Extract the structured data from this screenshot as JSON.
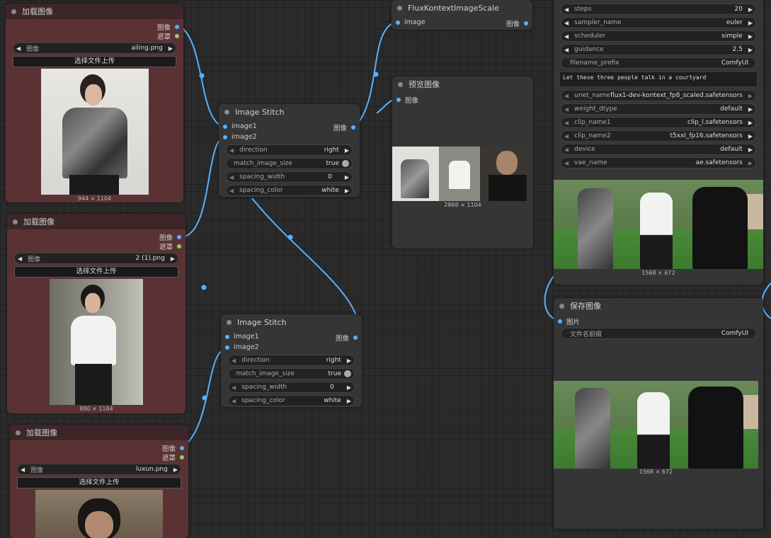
{
  "load_nodes": [
    {
      "title": "加载图像",
      "output_image": "图像",
      "output_mask": "遮罩",
      "image_label": "图像",
      "image_value": "ailing.png",
      "upload_label": "选择文件上传",
      "size": "944 × 1104"
    },
    {
      "title": "加载图像",
      "output_image": "图像",
      "output_mask": "遮罩",
      "image_label": "图像",
      "image_value": "2 (1).png",
      "upload_label": "选择文件上传",
      "size": "880 × 1184"
    },
    {
      "title": "加载图像",
      "output_image": "图像",
      "output_mask": "遮罩",
      "image_label": "图像",
      "image_value": "luxun.png",
      "upload_label": "选择文件上传",
      "size": ""
    }
  ],
  "stitch_nodes": [
    {
      "title": "Image Stitch",
      "input1": "image1",
      "input2": "image2",
      "output": "图像",
      "widgets": [
        {
          "label": "direction",
          "value": "right"
        },
        {
          "label": "match_image_size",
          "value": "true"
        },
        {
          "label": "spacing_width",
          "value": "0"
        },
        {
          "label": "spacing_color",
          "value": "white"
        }
      ]
    },
    {
      "title": "Image Stitch",
      "input1": "image1",
      "input2": "image2",
      "output": "图像",
      "widgets": [
        {
          "label": "direction",
          "value": "right"
        },
        {
          "label": "match_image_size",
          "value": "true"
        },
        {
          "label": "spacing_width",
          "value": "0"
        },
        {
          "label": "spacing_color",
          "value": "white"
        }
      ]
    }
  ],
  "scale_node": {
    "title": "FluxKontextImageScale",
    "input": "image",
    "output": "图像"
  },
  "preview_node": {
    "title": "预览图像",
    "input": "图像",
    "size": "2868 × 1104"
  },
  "sampler_panel": {
    "widgets": [
      {
        "label": "steps",
        "value": "20"
      },
      {
        "label": "sampler_name",
        "value": "euler"
      },
      {
        "label": "scheduler",
        "value": "simple"
      },
      {
        "label": "guidance",
        "value": "2.5"
      }
    ],
    "filename_prefix": {
      "label": "filename_prefix",
      "value": "ComfyUI"
    },
    "prompt": "Let these three people talk in a courtyard",
    "loaders": [
      {
        "label": "unet_name",
        "value": "flux1-dev-kontext_fp8_scaled.safetensors"
      },
      {
        "label": "weight_dtype",
        "value": "default"
      },
      {
        "label": "clip_name1",
        "value": "clip_l.safetensors"
      },
      {
        "label": "clip_name2",
        "value": "t5xxl_fp16.safetensors"
      },
      {
        "label": "device",
        "value": "default"
      },
      {
        "label": "vae_name",
        "value": "ae.safetensors"
      }
    ],
    "result_size": "1568 × 672"
  },
  "save_node": {
    "title": "保存图像",
    "input": "图片",
    "prefix_label": "文件名前缀",
    "prefix_value": "ComfyUI",
    "size": "1568 × 672"
  },
  "colors": {
    "wire": "#5ab0ff",
    "node_bg": "#353535",
    "load_node_bg": "#5a3234",
    "canvas": "#2b2b2b"
  }
}
